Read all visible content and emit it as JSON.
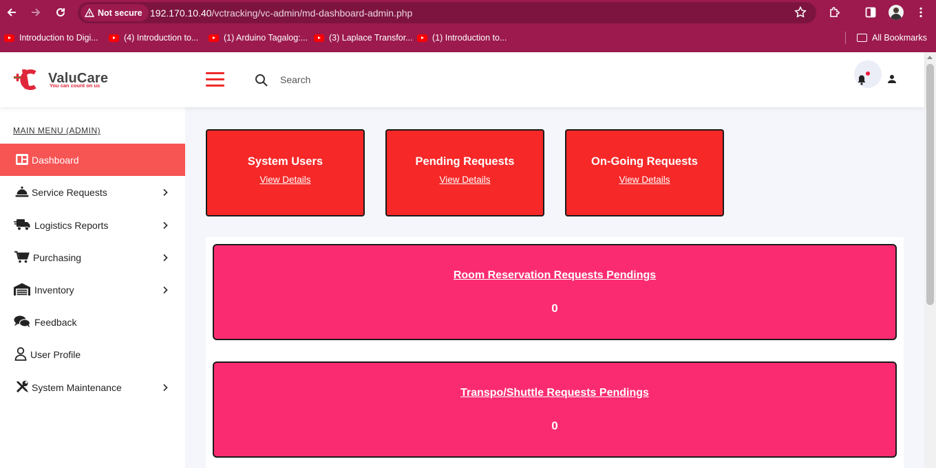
{
  "browser": {
    "security_label": "Not secure",
    "url_host": "192.170.10.40",
    "url_path": "/vctracking/vc-admin/md-dashboard-admin.php",
    "bookmarks": [
      {
        "label": "Introduction to Digi..."
      },
      {
        "label": "(4) Introduction to..."
      },
      {
        "label": "(1) Arduino Tagalog:..."
      },
      {
        "label": "(3) Laplace Transfor..."
      },
      {
        "label": "(1) Introduction to..."
      }
    ],
    "all_bookmarks_label": "All Bookmarks"
  },
  "header": {
    "brand_name": "ValuCare",
    "brand_tagline": "You can count on us",
    "search_placeholder": "Search"
  },
  "sidebar": {
    "menu_title": "MAIN MENU (ADMIN)",
    "items": [
      {
        "label": "Dashboard",
        "icon": "dashboard-icon",
        "active": true
      },
      {
        "label": "Service Requests",
        "icon": "service-bell-icon",
        "has_submenu": true
      },
      {
        "label": "Logistics Reports",
        "icon": "truck-icon",
        "has_submenu": true
      },
      {
        "label": "Purchasing",
        "icon": "cart-icon",
        "has_submenu": true
      },
      {
        "label": "Inventory",
        "icon": "warehouse-icon",
        "has_submenu": true
      },
      {
        "label": "Feedback",
        "icon": "comments-icon"
      },
      {
        "label": "User Profile",
        "icon": "user-icon"
      },
      {
        "label": "System Maintenance",
        "icon": "tools-icon",
        "has_submenu": true
      }
    ]
  },
  "cards": [
    {
      "title": "System Users",
      "link": "View Details"
    },
    {
      "title": "Pending Requests",
      "link": "View Details"
    },
    {
      "title": "On-Going Requests",
      "link": "View Details"
    }
  ],
  "pendings": [
    {
      "title": "Room Reservation Requests Pendings",
      "count": "0"
    },
    {
      "title": "Transpo/Shuttle Requests Pendings",
      "count": "0"
    }
  ],
  "colors": {
    "chrome": "#9c1a4e",
    "active_menu": "#f75454",
    "card_red": "#f62828",
    "pending_pink": "#fb2b72"
  }
}
